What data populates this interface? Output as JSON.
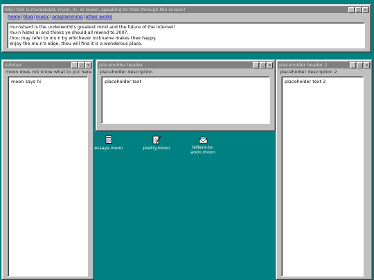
{
  "header_window": {
    "title": "hihi! this is mumshard, mum, m, or moon, speaking to thee through the screen!",
    "nav": [
      "home",
      "blog",
      "music",
      "programming",
      "other works"
    ],
    "intro_lines": [
      "mu·nshard is the underworld's greatest mind and the future of the internet!",
      "mu·n hates ai and thinks ye should all rewind to 2007.",
      "thou may refer to mu·n by whichever nickname makes thee happy.",
      "enjoy the mu·n's edge, thou will find it is a wonderous place."
    ]
  },
  "sidebar_window": {
    "title": "sidebar",
    "description": "moon does not know what to put here",
    "text": "moon says hi"
  },
  "placeholder_window": {
    "title": "placeholder header",
    "description": "placeholder description",
    "text": "placeholder text"
  },
  "placeholder_window_2": {
    "title": "placeholder header 2",
    "description": "placeholder description 2",
    "text": "placeholder text 2"
  },
  "window_controls": {
    "minimize": "_",
    "maximize": "□",
    "close": "×"
  },
  "desktop_icons": [
    {
      "label": "essays.moon",
      "icon": "document-icon"
    },
    {
      "label": "poetry.moon",
      "icon": "notepad-pen-icon"
    },
    {
      "label": "letters-to-anon.moon",
      "icon": "envelope-icon"
    }
  ],
  "colors": {
    "desktop": "#008080",
    "window": "#c0c0c0",
    "titlebar": "#808080",
    "link": "#0000c0"
  }
}
